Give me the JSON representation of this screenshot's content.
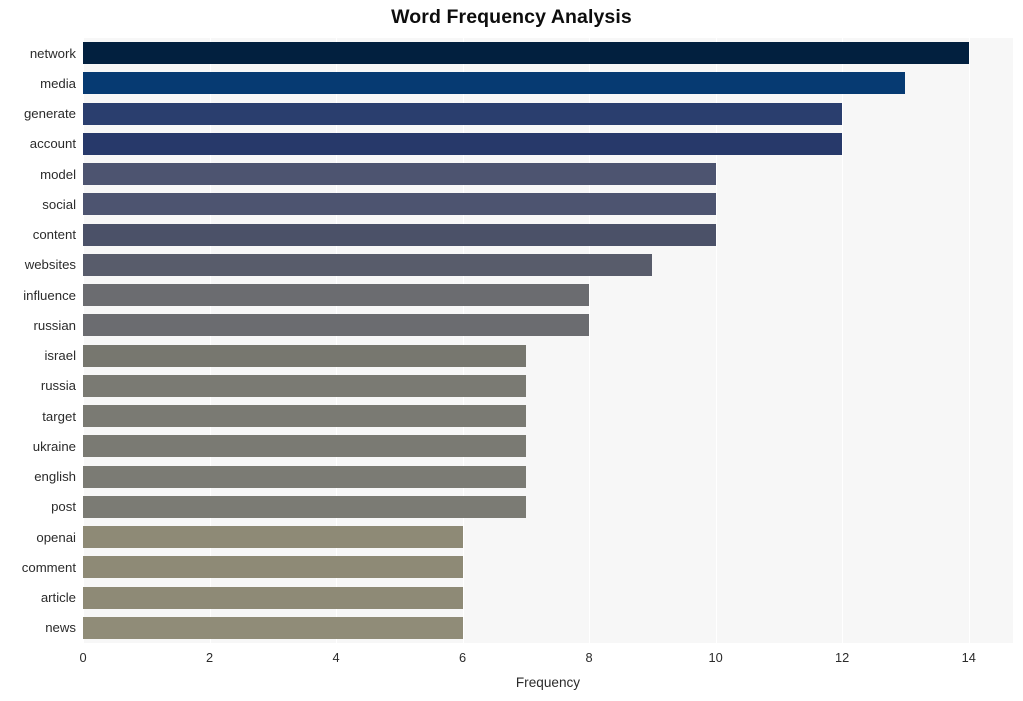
{
  "chart_data": {
    "type": "bar",
    "orientation": "horizontal",
    "title": "Word Frequency Analysis",
    "xlabel": "Frequency",
    "ylabel": "",
    "xlim": [
      0,
      14.7
    ],
    "ylim": null,
    "grid": true,
    "legend": false,
    "legend_position": "none",
    "xticks": [
      0,
      2,
      4,
      6,
      8,
      10,
      12,
      14
    ],
    "xticklabels": [
      "0",
      "2",
      "4",
      "6",
      "8",
      "10",
      "12",
      "14"
    ],
    "categories": [
      "network",
      "media",
      "generate",
      "account",
      "model",
      "social",
      "content",
      "websites",
      "influence",
      "russian",
      "israel",
      "russia",
      "target",
      "ukraine",
      "english",
      "post",
      "openai",
      "comment",
      "article",
      "news"
    ],
    "values": [
      14,
      13,
      12,
      12,
      10,
      10,
      10,
      9,
      8,
      8,
      7,
      7,
      7,
      7,
      7,
      7,
      6,
      6,
      6,
      6
    ],
    "bar_colors": [
      "#02203f",
      "#063a72",
      "#2a3e6e",
      "#27396a",
      "#4d5470",
      "#4d5470",
      "#4b5168",
      "#585c6b",
      "#6b6c70",
      "#6b6c70",
      "#77776f",
      "#7a7a73",
      "#7a7a73",
      "#7a7a73",
      "#7b7b74",
      "#7b7b74",
      "#8e8a76",
      "#8e8a76",
      "#8e8a76",
      "#908c78"
    ],
    "plot_background": "#f7f7f7",
    "gridline_color": "#ffffff",
    "figure_background": "#ffffff",
    "text_color": "#2b2b2b",
    "title_color": "#0d0d0d"
  }
}
